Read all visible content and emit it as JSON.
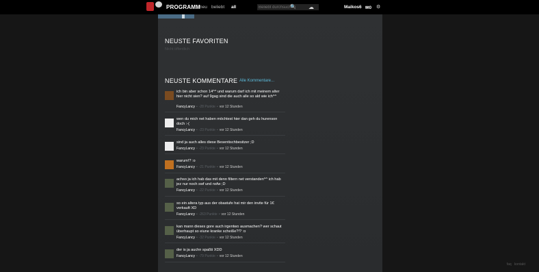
{
  "nav": {
    "logo_text": "PROGRAMM",
    "items": [
      {
        "label": "neu"
      },
      {
        "label": "beliebt"
      },
      {
        "label": "all"
      }
    ],
    "search_placeholder": "Beliebt durchsuchen",
    "user_name": "Maikos6",
    "messages_count": "0"
  },
  "favorites": {
    "title": "NEUSTE FAVORITEN",
    "hint": "Nicht öffentlich"
  },
  "comments": {
    "title": "NEUSTE KOMMENTARE",
    "all_link": "Alle Kommentare...",
    "items": [
      {
        "text": "ich bin aber schon 14^^ und warum darf ich mit meinem alter hier nicht sien? auf 9gag sind die auch alle so ald wie ich^^",
        "user": "FancyLancy",
        "points": "-28 Punkte",
        "time": "vor 12 Stunden"
      },
      {
        "text": "wen du mich net haben möchtest hier dan geh du hurenson doch :-(",
        "user": "FancyLancy",
        "points": "-23 Punkte",
        "time": "vor 12 Stunden"
      },
      {
        "text": "sind ja auch alles diese Besentischbesitzer ;D",
        "user": "FancyLancy",
        "points": "-23 Punkte",
        "time": "vor 12 Stunden"
      },
      {
        "text": "warum!? :o",
        "user": "FancyLancy",
        "points": "-21 Punkte",
        "time": "vor 12 Stunden"
      },
      {
        "text": "achso ja ich hab das mit denn filtern net verstanden^^ ich hab jez nur noch swf und nsfw ;D",
        "user": "FancyLancy",
        "points": "-22 Punkte",
        "time": "vor 12 Stunden"
      },
      {
        "text": "so ein altera typ aus der obastufe hat mir den invite für 1€ verkauft XD",
        "user": "FancyLancy",
        "points": "-263 Punkte",
        "time": "vor 12 Stunden"
      },
      {
        "text": "kan mann dieses gore auch irgentwo ausmachen? wer schaut überhaupt so eiune kranke scheiße?!? :o",
        "user": "FancyLancy",
        "points": "-32 Punkte",
        "time": "vor 12 Stunden"
      },
      {
        "text": "der is ja auchn spaßti XDD",
        "user": "FancyLancy",
        "points": "-79 Punkte",
        "time": "vor 12 Stunden"
      }
    ]
  },
  "footer": {
    "faq": "faq",
    "contact": "kontakt"
  }
}
